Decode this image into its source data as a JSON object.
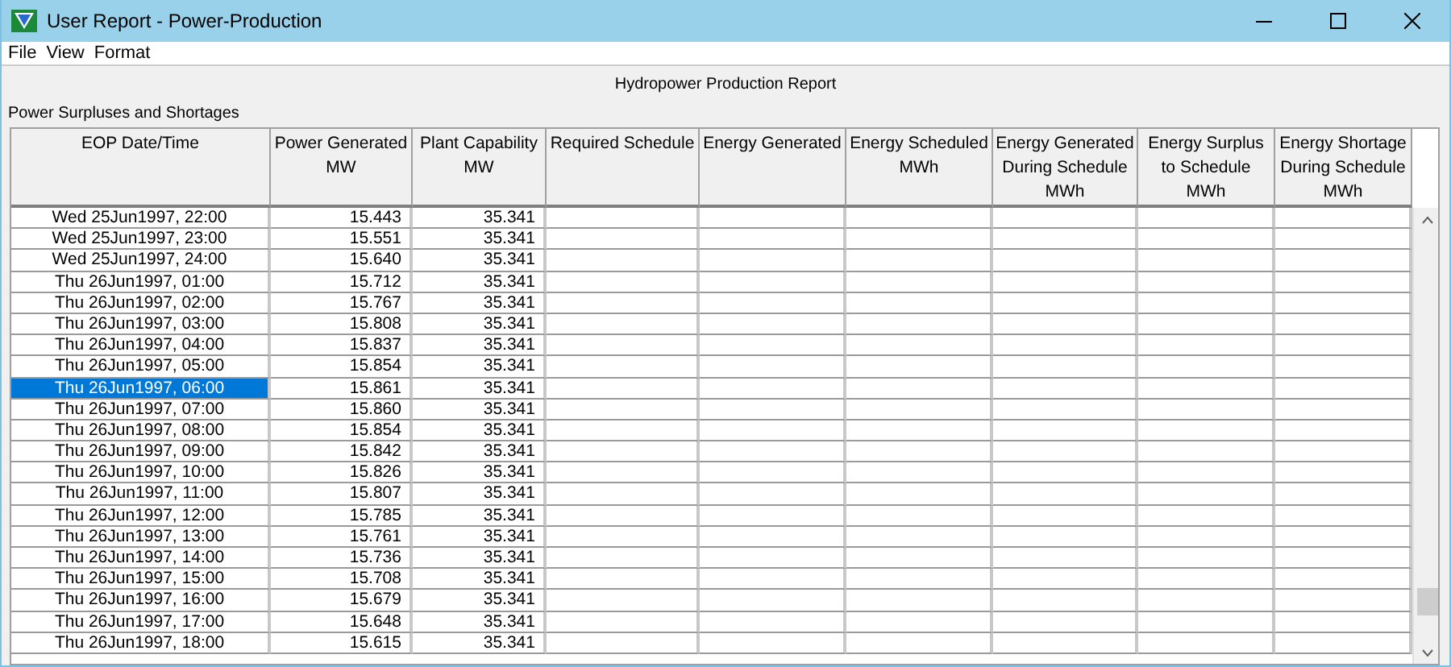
{
  "window": {
    "title": "User Report - Power-Production"
  },
  "menu": [
    "File",
    "View",
    "Format"
  ],
  "report_title": "Hydropower Production Report",
  "section_label": "Power Surpluses and Shortages",
  "table": {
    "columns": [
      {
        "lines": [
          "EOP Date/Time"
        ]
      },
      {
        "lines": [
          "Power Generated",
          "MW"
        ]
      },
      {
        "lines": [
          "Plant Capability",
          "MW"
        ]
      },
      {
        "lines": [
          "Required Schedule"
        ]
      },
      {
        "lines": [
          "Energy Generated"
        ]
      },
      {
        "lines": [
          "Energy Scheduled",
          "MWh"
        ]
      },
      {
        "lines": [
          "Energy Generated",
          "During Schedule",
          "MWh"
        ]
      },
      {
        "lines": [
          "Energy Surplus",
          "to Schedule",
          "MWh"
        ]
      },
      {
        "lines": [
          "Energy Shortage",
          "During Schedule",
          "MWh"
        ]
      }
    ],
    "rows": [
      {
        "cells": [
          "Wed 25Jun1997, 22:00",
          "15.443",
          "35.341"
        ],
        "selected": false
      },
      {
        "cells": [
          "Wed 25Jun1997, 23:00",
          "15.551",
          "35.341"
        ],
        "selected": false
      },
      {
        "cells": [
          "Wed 25Jun1997, 24:00",
          "15.640",
          "35.341"
        ],
        "selected": false
      },
      {
        "cells": [
          "Thu 26Jun1997, 01:00",
          "15.712",
          "35.341"
        ],
        "selected": false
      },
      {
        "cells": [
          "Thu 26Jun1997, 02:00",
          "15.767",
          "35.341"
        ],
        "selected": false
      },
      {
        "cells": [
          "Thu 26Jun1997, 03:00",
          "15.808",
          "35.341"
        ],
        "selected": false
      },
      {
        "cells": [
          "Thu 26Jun1997, 04:00",
          "15.837",
          "35.341"
        ],
        "selected": false
      },
      {
        "cells": [
          "Thu 26Jun1997, 05:00",
          "15.854",
          "35.341"
        ],
        "selected": false
      },
      {
        "cells": [
          "Thu 26Jun1997, 06:00",
          "15.861",
          "35.341"
        ],
        "selected": true
      },
      {
        "cells": [
          "Thu 26Jun1997, 07:00",
          "15.860",
          "35.341"
        ],
        "selected": false
      },
      {
        "cells": [
          "Thu 26Jun1997, 08:00",
          "15.854",
          "35.341"
        ],
        "selected": false
      },
      {
        "cells": [
          "Thu 26Jun1997, 09:00",
          "15.842",
          "35.341"
        ],
        "selected": false
      },
      {
        "cells": [
          "Thu 26Jun1997, 10:00",
          "15.826",
          "35.341"
        ],
        "selected": false
      },
      {
        "cells": [
          "Thu 26Jun1997, 11:00",
          "15.807",
          "35.341"
        ],
        "selected": false
      },
      {
        "cells": [
          "Thu 26Jun1997, 12:00",
          "15.785",
          "35.341"
        ],
        "selected": false
      },
      {
        "cells": [
          "Thu 26Jun1997, 13:00",
          "15.761",
          "35.341"
        ],
        "selected": false
      },
      {
        "cells": [
          "Thu 26Jun1997, 14:00",
          "15.736",
          "35.341"
        ],
        "selected": false
      },
      {
        "cells": [
          "Thu 26Jun1997, 15:00",
          "15.708",
          "35.341"
        ],
        "selected": false
      },
      {
        "cells": [
          "Thu 26Jun1997, 16:00",
          "15.679",
          "35.341"
        ],
        "selected": false
      },
      {
        "cells": [
          "Thu 26Jun1997, 17:00",
          "15.648",
          "35.341"
        ],
        "selected": false
      },
      {
        "cells": [
          "Thu 26Jun1997, 18:00",
          "15.615",
          "35.341"
        ],
        "selected": false
      }
    ]
  }
}
